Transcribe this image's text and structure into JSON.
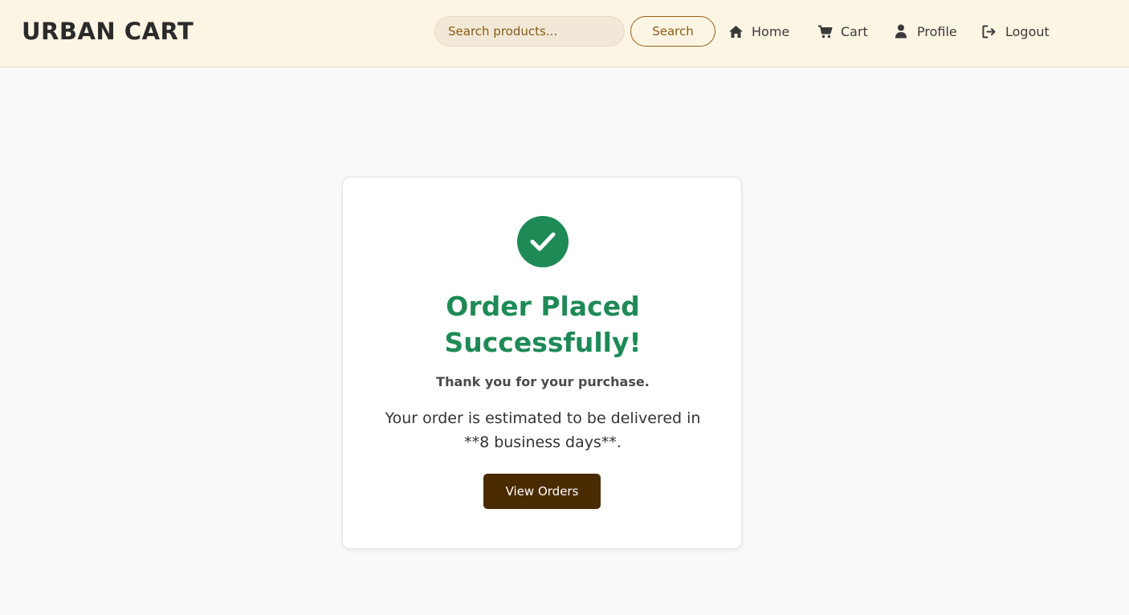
{
  "header": {
    "brand": "URBAN CART",
    "search_placeholder": "Search products...",
    "search_button": "Search",
    "nav": {
      "home": {
        "label": "Home",
        "icon": "home-icon"
      },
      "cart": {
        "label": "Cart",
        "icon": "cart-icon"
      },
      "profile": {
        "label": "Profile",
        "icon": "user-icon"
      },
      "logout": {
        "label": "Logout",
        "icon": "logout-icon"
      }
    }
  },
  "confirmation": {
    "icon": "check-circle-icon",
    "title": "Order Placed Successfully!",
    "thanks": "Thank you for your purchase.",
    "delivery_message": "Your order is estimated to be delivered in **8 business days**.",
    "view_orders_button": "View Orders"
  },
  "colors": {
    "navbar_bg": "#fdf5e4",
    "accent_brown": "#8a5a14",
    "success_green": "#1e8a56",
    "button_dark_brown": "#4a2b00",
    "page_bg": "#f7f9fb"
  }
}
